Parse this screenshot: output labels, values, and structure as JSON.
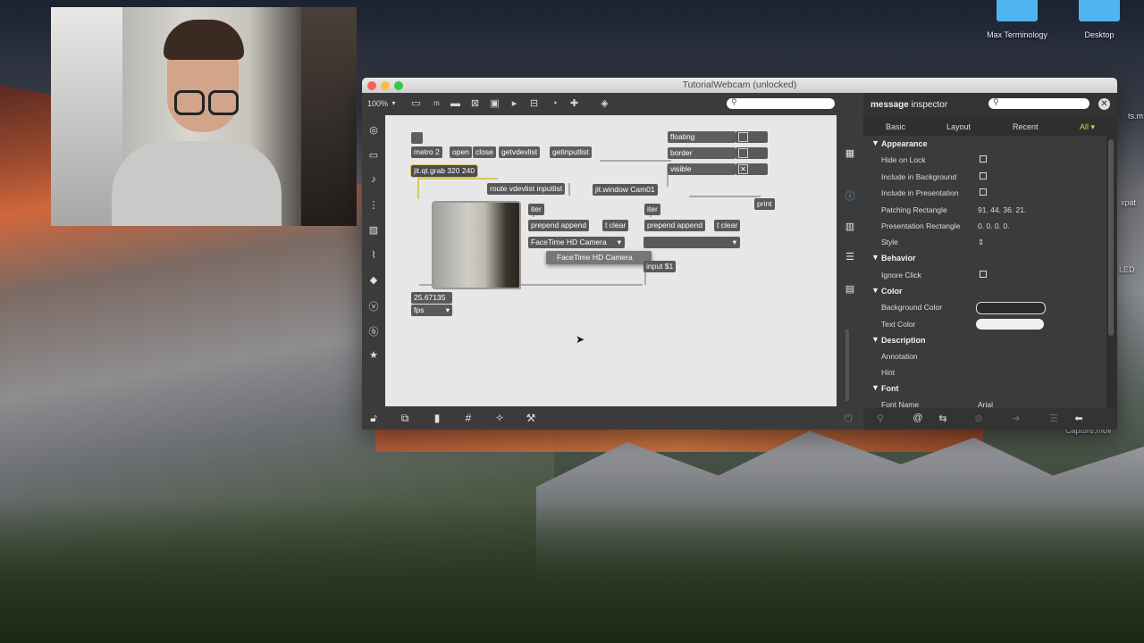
{
  "desktop": {
    "icons": [
      "Max Terminology",
      "Desktop",
      "Capture.mov"
    ],
    "edge_fragments": [
      "ts.m",
      "xpat",
      "LED"
    ]
  },
  "window": {
    "title": "TutorialWebcam (unlocked)",
    "zoom": "100%"
  },
  "patch": {
    "close_box": "✕",
    "objects": {
      "metro": "metro 2",
      "open": "open",
      "close": "close",
      "getvdevlist": "getvdevlist",
      "getinputlist": "getinputlist",
      "grab": "jit.qt.grab 320 240",
      "route": "route vdevlist inputlist",
      "window": "jit.window Cam01",
      "print": "print",
      "iter1": "iter",
      "iter2": "iter",
      "prepend1": "prepend append",
      "prepend2": "prepend append",
      "clear1": "t clear",
      "clear2": "t clear",
      "menu1": "FaceTime HD Camera",
      "menu_popup": "FaceTime HD Camera",
      "menu2": "",
      "input": "input $1",
      "floating": "floating",
      "border": "border",
      "visible": "visible",
      "visible_check": "✕",
      "fps_value": "25.67135",
      "fps_label": "fps"
    }
  },
  "inspector": {
    "title_bold": "message",
    "title_rest": " inspector",
    "tabs": [
      "Basic",
      "Layout",
      "Recent",
      "All ▾"
    ],
    "sections": {
      "appearance": "Appearance",
      "behavior": "Behavior",
      "color": "Color",
      "description": "Description",
      "font": "Font"
    },
    "rows": {
      "hide_on_lock": "Hide on Lock",
      "include_bg": "Include in Background",
      "include_pres": "Include in Presentation",
      "patching_rect": "Patching Rectangle",
      "patching_rect_val": "91. 44. 36. 21.",
      "pres_rect": "Presentation Rectangle",
      "pres_rect_val": "0. 0. 0. 0.",
      "style": "Style",
      "style_val": "⇕",
      "ignore_click": "Ignore Click",
      "bg_color": "Background Color",
      "text_color": "Text Color",
      "annotation": "Annotation",
      "hint": "Hint",
      "font_name": "Font Name",
      "font_name_val": "Arial"
    },
    "colors": {
      "background": "#2b2b2b",
      "text": "#f0f0f0"
    }
  }
}
